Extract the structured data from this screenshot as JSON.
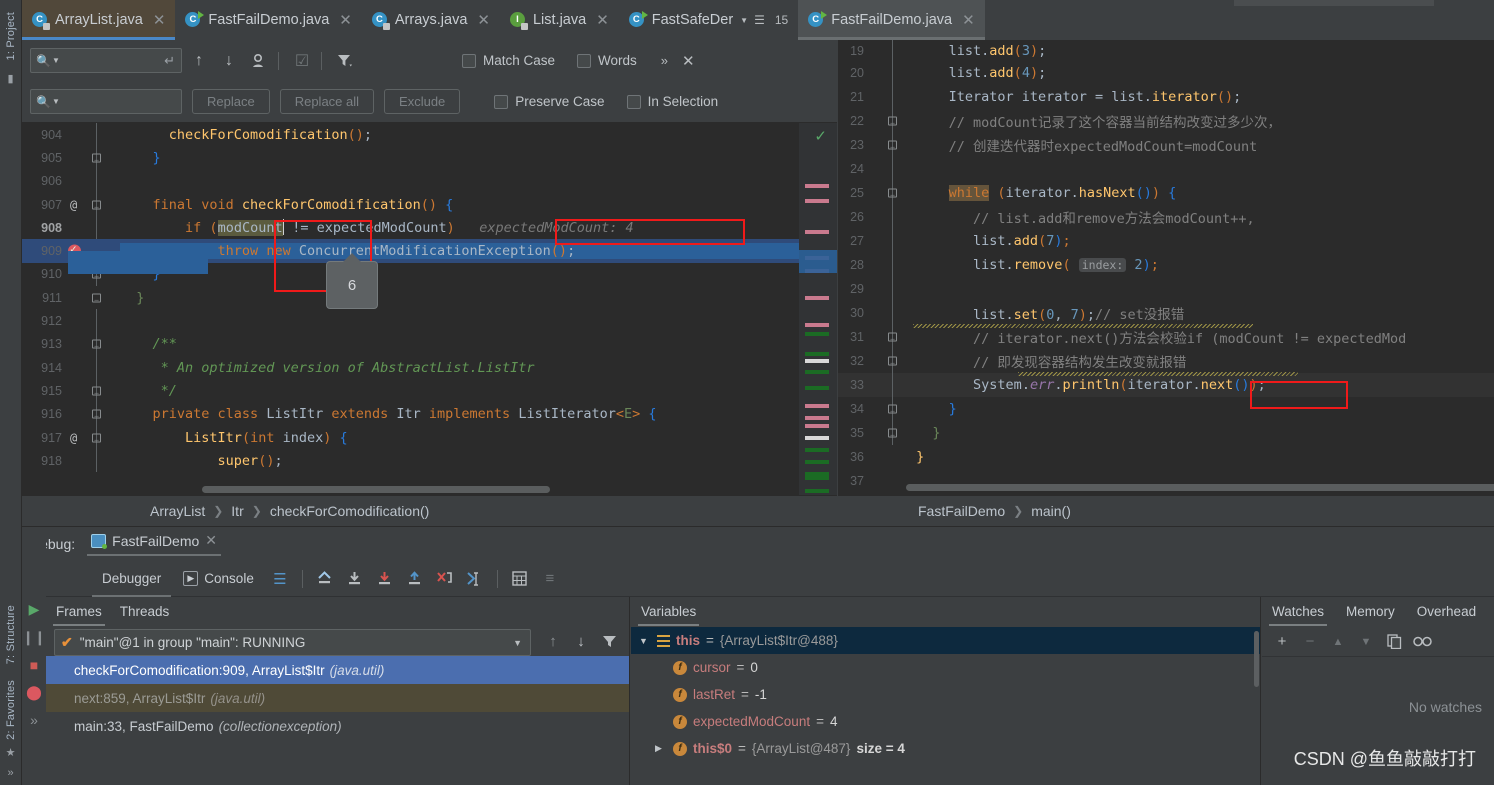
{
  "left_tool_strip": {
    "items": [
      {
        "label": "1: Project",
        "icon": "folder-icon"
      },
      {
        "label": "7: Structure",
        "icon": "structure-icon"
      },
      {
        "label": "2: Favorites",
        "icon": "star-icon"
      }
    ],
    "more": "»"
  },
  "tabs": [
    {
      "label": "ArrayList.java",
      "icon": "class-icon",
      "locked": true,
      "state": "active-editor",
      "close": "✕"
    },
    {
      "label": "FastFailDemo.java",
      "icon": "runnable-class-icon",
      "locked": false,
      "state": "normal",
      "close": "✕"
    },
    {
      "label": "Arrays.java",
      "icon": "class-icon",
      "locked": true,
      "state": "normal",
      "close": "✕"
    },
    {
      "label": "List.java",
      "icon": "interface-icon",
      "locked": true,
      "state": "normal",
      "close": "✕"
    },
    {
      "label": "FastSafeDer",
      "icon": "runnable-class-icon",
      "locked": false,
      "state": "normal",
      "badge": "15",
      "close": ""
    },
    {
      "label": "FastFailDemo.java",
      "icon": "runnable-class-icon",
      "locked": false,
      "state": "selected-right",
      "close": "✕"
    }
  ],
  "find_bar": {
    "search_value": "",
    "replace_value": "",
    "search_icon": "search-icon",
    "buttons": {
      "prev": "↑",
      "next": "↓",
      "select_all_occurrences": "ⓘ",
      "preserve": "☑",
      "filter": "filter-icon",
      "replace": "Replace",
      "replace_all": "Replace all",
      "exclude": "Exclude",
      "more": "»",
      "close": "✕"
    },
    "checkboxes": [
      {
        "label": "Match Case",
        "checked": false
      },
      {
        "label": "Words",
        "checked": false
      },
      {
        "label": "Preserve Case",
        "checked": false
      },
      {
        "label": "In Selection",
        "checked": false
      }
    ]
  },
  "editor_left": {
    "file": "ArrayList.java",
    "breadcrumb": [
      "ArrayList",
      "Itr",
      "checkForComodification()"
    ],
    "inline_hint": "expectedModCount: 4",
    "tooltip_value": "6",
    "lines": [
      {
        "n": "904",
        "code": "            checkForComodification();"
      },
      {
        "n": "905",
        "code": "        }"
      },
      {
        "n": "906",
        "code": ""
      },
      {
        "n": "907",
        "code": "    final void checkForComodification() {"
      },
      {
        "n": "908",
        "code": "        if (modCount != expectedModCount)"
      },
      {
        "n": "909",
        "code": "            throw new ConcurrentModificationException();"
      },
      {
        "n": "910",
        "code": "    }"
      },
      {
        "n": "911",
        "code": "}"
      },
      {
        "n": "912",
        "code": ""
      },
      {
        "n": "913",
        "code": "    /**"
      },
      {
        "n": "914",
        "code": "     * An optimized version of AbstractList.ListItr"
      },
      {
        "n": "915",
        "code": "     */"
      },
      {
        "n": "916",
        "code": "    private class ListItr extends Itr implements ListIterator<E> {"
      },
      {
        "n": "917",
        "code": "        ListItr(int index) {"
      },
      {
        "n": "918",
        "code": "            super();"
      }
    ]
  },
  "editor_right": {
    "file": "FastFailDemo.java",
    "breadcrumb": [
      "FastFailDemo",
      "main()"
    ],
    "lines": [
      {
        "n": "19",
        "code": "        list.add(3);"
      },
      {
        "n": "20",
        "code": "        list.add(4);"
      },
      {
        "n": "21",
        "code": "        Iterator iterator = list.iterator();"
      },
      {
        "n": "22",
        "code": "        // modCount记录了这个容器当前结构改变过多少次，"
      },
      {
        "n": "23",
        "code": "        // 创建迭代器时expectedModCount=modCount"
      },
      {
        "n": "24",
        "code": ""
      },
      {
        "n": "25",
        "code": "        while (iterator.hasNext()) {"
      },
      {
        "n": "26",
        "code": "            // list.add和remove方法会modCount++,"
      },
      {
        "n": "27",
        "code": "            list.add(7);"
      },
      {
        "n": "28",
        "code": "            list.remove( index: 2);"
      },
      {
        "n": "29",
        "code": ""
      },
      {
        "n": "30",
        "code": "            list.set(0, 7);// set没报错"
      },
      {
        "n": "31",
        "code": "            // iterator.next()方法会校验if (modCount != expectedMod"
      },
      {
        "n": "32",
        "code": "            // 即发现容器结构发生改变就报错"
      },
      {
        "n": "33",
        "code": "            System.err.println(iterator.next());"
      },
      {
        "n": "34",
        "code": "        }"
      },
      {
        "n": "35",
        "code": "    }"
      },
      {
        "n": "36",
        "code": "}"
      },
      {
        "n": "37",
        "code": ""
      }
    ]
  },
  "debug": {
    "label": "Debug:",
    "config_name": "FastFailDemo",
    "close": "✕",
    "tabs": [
      {
        "label": "Debugger",
        "selected": true
      },
      {
        "label": "Console",
        "selected": false
      }
    ],
    "toolbar_icons": [
      "rerun-icon",
      "show-execution-point-icon",
      "step-over-icon",
      "step-into-icon",
      "force-step-into-icon",
      "step-out-icon",
      "drop-frame-icon",
      "run-to-cursor-icon",
      "evaluate-expression-icon",
      "settings-icon"
    ],
    "side_icons": [
      "resume-icon",
      "pause-icon",
      "stop-icon",
      "view-breakpoints-icon",
      "more-icon"
    ],
    "frames_panel": {
      "tabs": [
        {
          "label": "Frames",
          "selected": true
        },
        {
          "label": "Threads",
          "selected": false
        }
      ],
      "thread_selector": "\"main\"@1 in group \"main\": RUNNING",
      "toolbar": [
        "↑",
        "↓",
        "filter-icon"
      ],
      "frames": [
        {
          "text": "checkForComodification:909, ArrayList$Itr",
          "pkg": "(java.util)",
          "state": "selected"
        },
        {
          "text": "next:859, ArrayList$Itr",
          "pkg": "(java.util)",
          "state": "muted"
        },
        {
          "text": "main:33, FastFailDemo",
          "pkg": "(collectionexception)",
          "state": "normal"
        }
      ]
    },
    "variables_panel": {
      "tab": "Variables",
      "rows": [
        {
          "indent": 0,
          "expander": "▼",
          "icon": "list-icon",
          "name": "this",
          "eq": "=",
          "value": "{ArrayList$Itr@488}",
          "extra": "",
          "selected": true
        },
        {
          "indent": 1,
          "expander": "",
          "icon": "field-icon",
          "name": "cursor",
          "eq": "=",
          "value": "0",
          "extra": "",
          "selected": false
        },
        {
          "indent": 1,
          "expander": "",
          "icon": "field-icon",
          "name": "lastRet",
          "eq": "=",
          "value": "-1",
          "extra": "",
          "selected": false
        },
        {
          "indent": 1,
          "expander": "",
          "icon": "field-icon",
          "name": "expectedModCount",
          "eq": "=",
          "value": "4",
          "extra": "",
          "selected": false
        },
        {
          "indent": 1,
          "expander": "▶",
          "icon": "field-icon",
          "name": "this$0",
          "eq": "=",
          "value": "{ArrayList@487}",
          "extra": "size = 4",
          "selected": false
        }
      ]
    },
    "watches_panel": {
      "tabs": [
        {
          "label": "Watches",
          "selected": true
        },
        {
          "label": "Memory",
          "selected": false
        },
        {
          "label": "Overhead",
          "selected": false
        }
      ],
      "toolbar": [
        "+",
        "−",
        "▲",
        "▼",
        "copy-icon",
        "glasses-icon"
      ],
      "empty_text": "No watches"
    }
  },
  "watermark": "CSDN @鱼鱼敲敲打打",
  "colors": {
    "accent_blue": "#4a88c7",
    "selection_blue": "#2b6099",
    "frame_selected": "#4b6eaf",
    "red_annotation": "#f01a1a",
    "breakpoint_red": "#db5860",
    "keyword_orange": "#cc7832",
    "string_green": "#6a8759",
    "comment_gray": "#808080",
    "method_yellow": "#ffc66d",
    "number_blue": "#6897bb",
    "editor_bg": "#2b2b2b",
    "chrome_bg": "#3c3f41"
  }
}
